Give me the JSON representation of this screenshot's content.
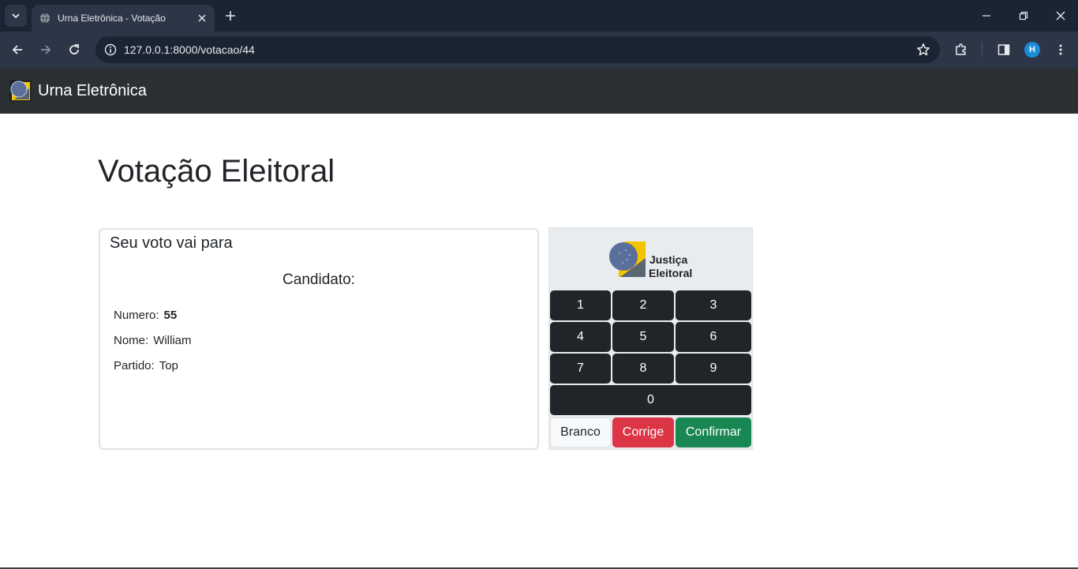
{
  "browser": {
    "tab_title": "Urna Eletrônica - Votação",
    "url": "127.0.0.1:8000/votacao/44",
    "profile_initial": "H",
    "icons": [
      "tab-search-icon",
      "globe-icon",
      "close-icon",
      "plus-icon",
      "minimize-icon",
      "restore-icon",
      "close-window-icon",
      "back-icon",
      "forward-icon",
      "reload-icon",
      "info-icon",
      "star-icon",
      "extensions-icon",
      "side-panel-icon",
      "menu-icon"
    ]
  },
  "navbar": {
    "brand": "Urna Eletrônica"
  },
  "page": {
    "title": "Votação Eleitoral"
  },
  "screen": {
    "heading": "Seu voto vai para",
    "candidate_title": "Candidato:",
    "fields": {
      "numero_label": "Numero:",
      "numero_value": "55",
      "nome_label": "Nome:",
      "nome_value": "William",
      "partido_label": "Partido:",
      "partido_value": "Top"
    }
  },
  "keypad": {
    "logo_text_1": "Justiça",
    "logo_text_2": "Eleitoral",
    "keys": [
      "1",
      "2",
      "3",
      "4",
      "5",
      "6",
      "7",
      "8",
      "9",
      "0"
    ],
    "branco": "Branco",
    "corrige": "Corrige",
    "confirmar": "Confirmar"
  },
  "colors": {
    "navbar": "#2b3035",
    "key_dark": "#212529",
    "corrige": "#dc3545",
    "confirmar": "#198754",
    "chrome_dark": "#1b2433",
    "chrome_toolbar": "#2c3646"
  }
}
